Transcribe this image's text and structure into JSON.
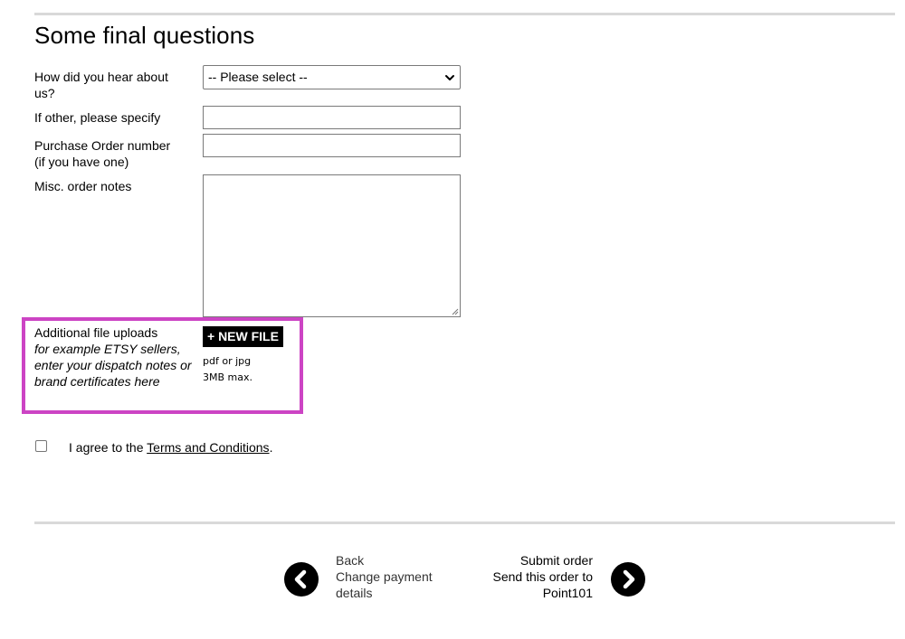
{
  "section": {
    "title": "Some final questions"
  },
  "fields": {
    "hear_about_label": "How did you hear about us?",
    "hear_about_selected": "-- Please select --",
    "other_label": "If other, please specify",
    "other_value": "",
    "po_label_line1": "Purchase Order number",
    "po_label_line2": "(if you have one)",
    "po_value": "",
    "notes_label": "Misc. order notes",
    "notes_value": ""
  },
  "uploads": {
    "label": "Additional file uploads",
    "hint": "for example ETSY sellers, enter your dispatch notes or brand certificates here",
    "button_label": "+ NEW FILE",
    "format_note": "pdf or jpg",
    "size_note": "3MB max.",
    "highlight_color": "#cc44c4"
  },
  "terms": {
    "checked": false,
    "prefix": "I agree to the",
    "link_text": "Terms and Conditions",
    "suffix": "."
  },
  "navigation": {
    "back_title": "Back",
    "back_subtitle_line1": "Change payment",
    "back_subtitle_line2": "details",
    "back_icon": "chevron-left-circle-icon",
    "submit_title": "Submit order",
    "submit_subtitle_line1": "Send this order to",
    "submit_subtitle_line2": "Point101",
    "submit_icon": "chevron-right-circle-icon"
  }
}
